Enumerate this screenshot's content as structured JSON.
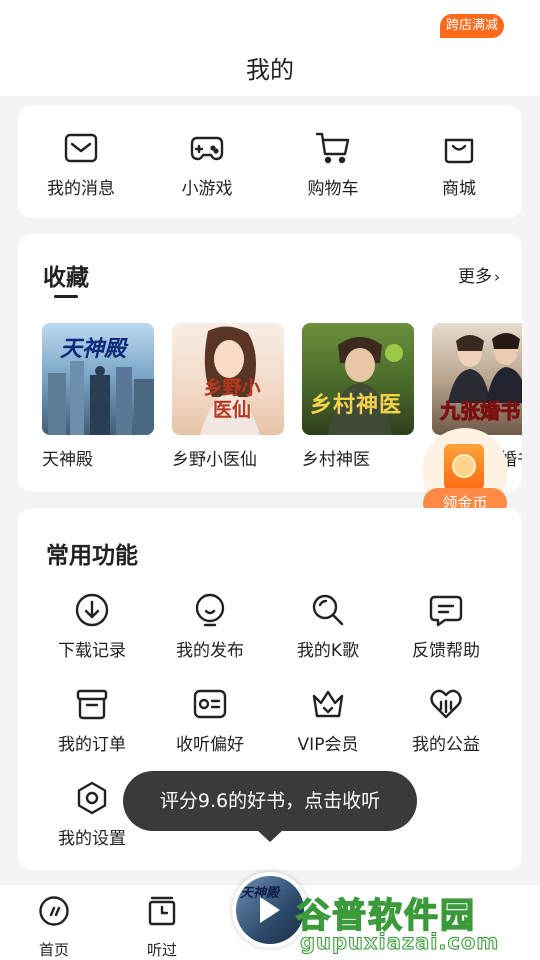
{
  "header": {
    "title": "我的"
  },
  "shortcuts": {
    "items": [
      {
        "label": "我的消息",
        "icon": "message-icon"
      },
      {
        "label": "小游戏",
        "icon": "gamepad-icon"
      },
      {
        "label": "购物车",
        "icon": "cart-icon"
      },
      {
        "label": "商城",
        "icon": "shopping-bag-icon"
      }
    ],
    "badge": "跨店满减"
  },
  "collection": {
    "title": "收藏",
    "more": "更多",
    "books": [
      {
        "title": "天神殿",
        "cover_text": "天神殿"
      },
      {
        "title": "乡野小医仙",
        "cover_text": "乡野小医仙"
      },
      {
        "title": "乡村神医",
        "cover_text": "乡村神医"
      },
      {
        "title": "开局九张婚书",
        "cover_text": "九张婚书"
      }
    ]
  },
  "coin": {
    "label": "领金币"
  },
  "functions": {
    "title": "常用功能",
    "items": [
      {
        "label": "下载记录",
        "icon": "download-icon"
      },
      {
        "label": "我的发布",
        "icon": "bulb-icon"
      },
      {
        "label": "我的K歌",
        "icon": "microphone-icon"
      },
      {
        "label": "反馈帮助",
        "icon": "feedback-icon"
      },
      {
        "label": "我的订单",
        "icon": "order-box-icon"
      },
      {
        "label": "收听偏好",
        "icon": "preference-card-icon"
      },
      {
        "label": "VIP会员",
        "icon": "crown-icon"
      },
      {
        "label": "我的公益",
        "icon": "heart-icon"
      },
      {
        "label": "我的设置",
        "icon": "settings-hexagon-icon"
      }
    ]
  },
  "tooltip": {
    "text": "评分9.6的好书，点击收听"
  },
  "bottom_nav": {
    "items": [
      {
        "label": "首页",
        "icon": "home-dial-icon"
      },
      {
        "label": "听过",
        "icon": "history-clock-icon"
      }
    ],
    "player_cover_text": "天神殿"
  },
  "watermark": {
    "main": "谷普软件园",
    "sub": "gupuxiazai.com"
  },
  "colors": {
    "accent": "#ff6a1a",
    "coin_button": "#ff8a45",
    "tooltip_bg": "#3a3a3a"
  }
}
